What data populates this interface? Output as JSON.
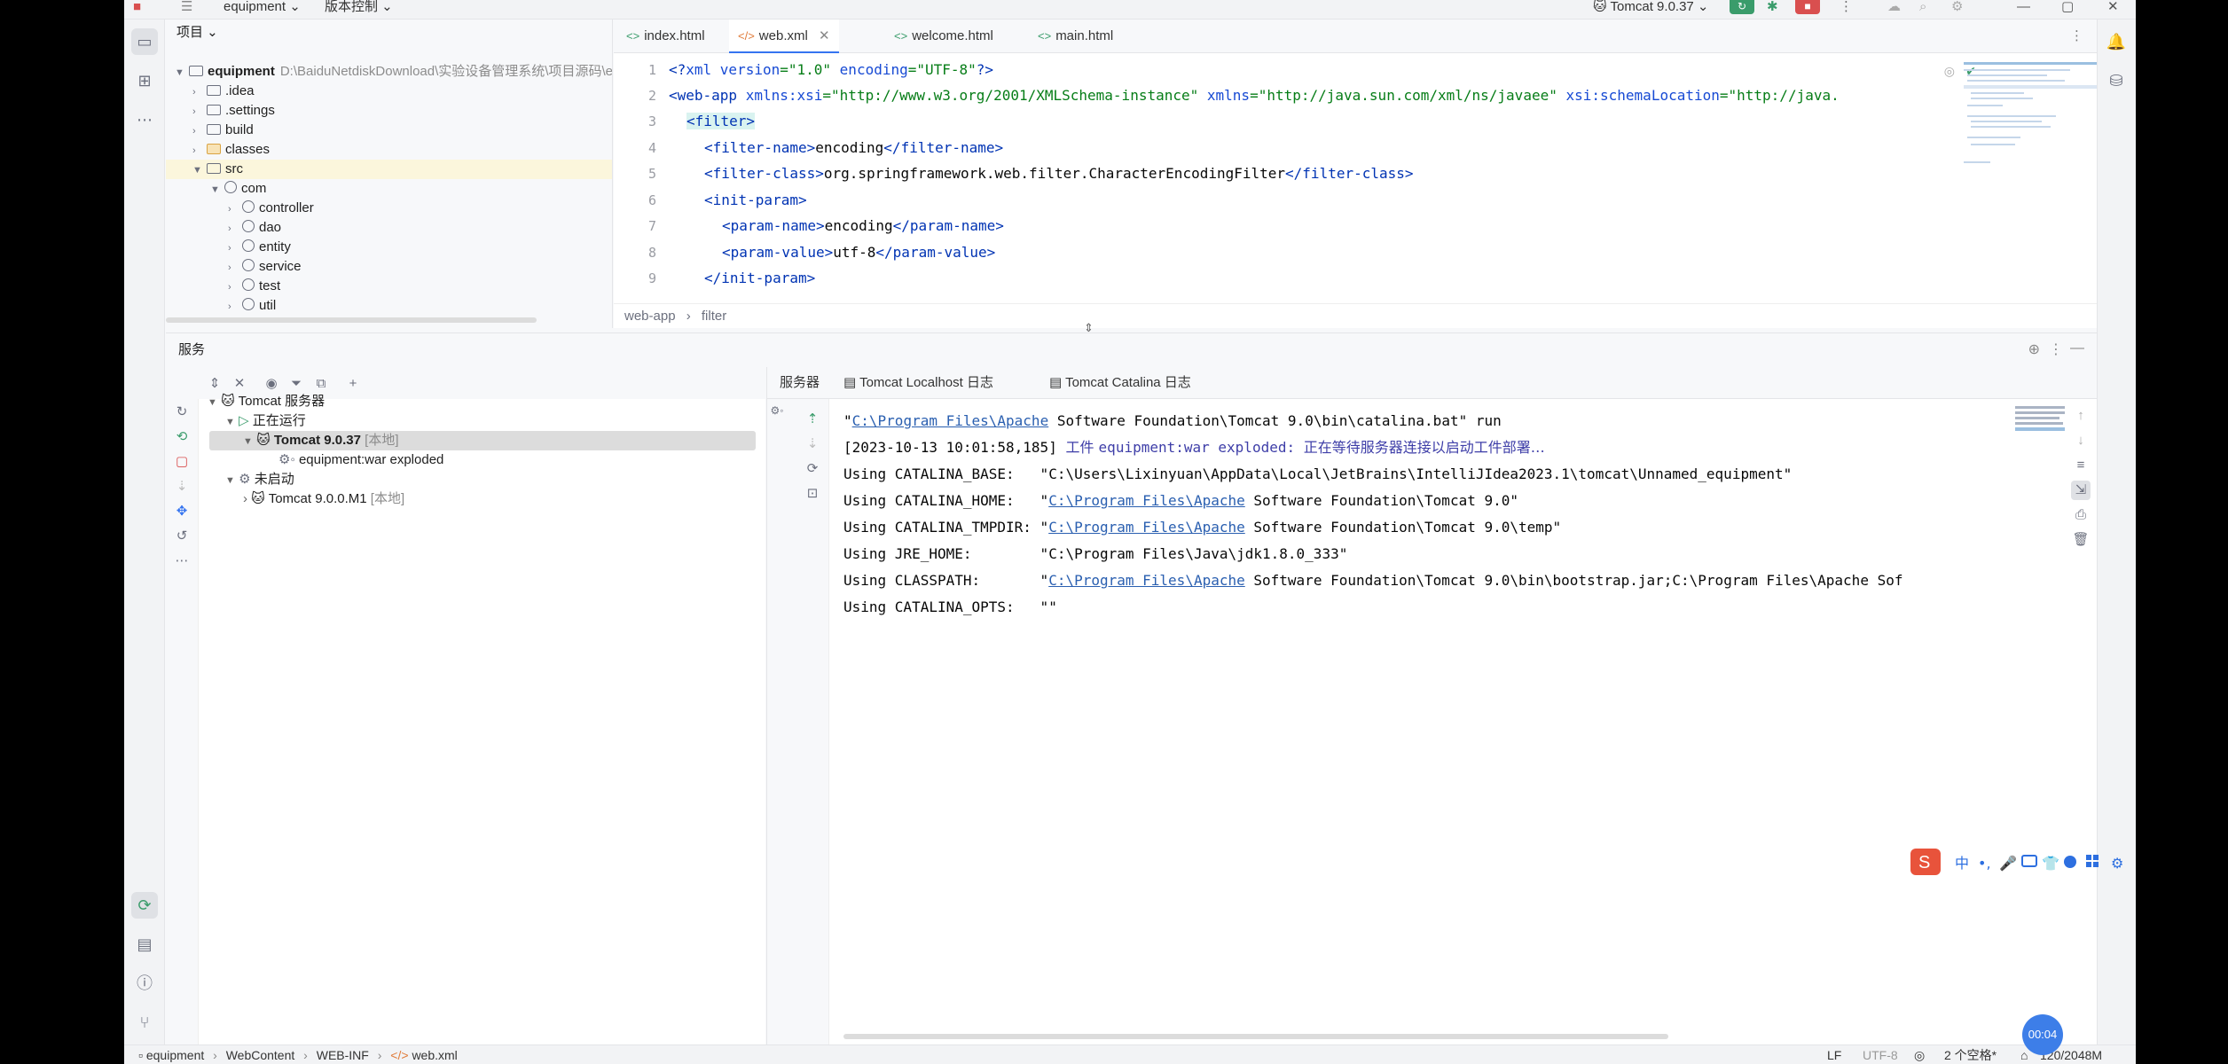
{
  "titlebar": {
    "project": "equipment",
    "vcs": "版本控制",
    "run_config": "Tomcat 9.0.37"
  },
  "project_panel": {
    "title": "项目",
    "tree": [
      {
        "name": "equipment",
        "path": "D:\\BaiduNetdiskDownload\\实验设备管理系统\\项目源码\\e",
        "depth": 0,
        "expanded": true
      },
      {
        "name": ".idea",
        "depth": 1
      },
      {
        "name": ".settings",
        "depth": 1
      },
      {
        "name": "build",
        "depth": 1
      },
      {
        "name": "classes",
        "depth": 1,
        "highlight": true
      },
      {
        "name": "src",
        "depth": 1,
        "expanded": true
      },
      {
        "name": "com",
        "depth": 2,
        "expanded": true
      },
      {
        "name": "controller",
        "depth": 3
      },
      {
        "name": "dao",
        "depth": 3
      },
      {
        "name": "entity",
        "depth": 3
      },
      {
        "name": "service",
        "depth": 3
      },
      {
        "name": "test",
        "depth": 3
      },
      {
        "name": "util",
        "depth": 3
      }
    ]
  },
  "editor": {
    "tabs": [
      "index.html",
      "web.xml",
      "welcome.html",
      "main.html"
    ],
    "active_tab": "web.xml",
    "breadcrumb": [
      "web-app",
      "filter"
    ],
    "line_numbers": [
      "1",
      "2",
      "3",
      "4",
      "5",
      "6",
      "7",
      "8",
      "9"
    ],
    "lines": {
      "l1_a": "<?",
      "l1_b": "xml version",
      "l1_c": "=\"1.0\" ",
      "l1_d": "encoding",
      "l1_e": "=\"UTF-8\"",
      "l1_f": "?>",
      "l2_tag": "<web-app ",
      "l2_a1": "xmlns:xsi",
      "l2_v1": "=\"http://www.w3.org/2001/XMLSchema-instance\" ",
      "l2_a2": "xmlns",
      "l2_v2": "=\"http://java.sun.com/xml/ns/javaee\" ",
      "l2_a3": "xsi:schemaLocation",
      "l2_v3": "=\"http://java.",
      "l3": "<filter>",
      "l4_open": "<filter-name>",
      "l4_text": "encoding",
      "l4_close": "</filter-name>",
      "l5_open": "<filter-class>",
      "l5_text": "org.springframework.web.filter.CharacterEncodingFilter",
      "l5_close": "</filter-class>",
      "l6": "<init-param>",
      "l7_open": "<param-name>",
      "l7_text": "encoding",
      "l7_close": "</param-name>",
      "l8_open": "<param-value>",
      "l8_text": "utf-8",
      "l8_close": "</param-value>",
      "l9": "</init-param>"
    }
  },
  "services": {
    "title": "服务",
    "tree": {
      "root": "Tomcat 服务器",
      "running": "正在运行",
      "server1": "Tomcat 9.0.37",
      "server1_tag": "[本地]",
      "artifact": "equipment:war exploded",
      "stopped": "未启动",
      "server2": "Tomcat 9.0.0.M1",
      "server2_tag": "[本地]"
    },
    "console_tabs": [
      "服务器",
      "Tomcat Localhost 日志",
      "Tomcat Catalina 日志"
    ],
    "console": {
      "line1_q": "\"",
      "line1_link": "C:\\Program Files\\Apache",
      "line1_rest": " Software Foundation\\Tomcat 9.0\\bin\\catalina.bat\" run",
      "line2_ts": "[2023-10-13 10:01:58,185] ",
      "line2_zh1": "工件 ",
      "line2_art": "equipment:war exploded: ",
      "line2_zh2": "正在等待服务器连接以启动工件部署…",
      "line3": "Using CATALINA_BASE:   \"C:\\Users\\Lixinyuan\\AppData\\Local\\JetBrains\\IntelliJIdea2023.1\\tomcat\\Unnamed_equipment\"",
      "line4_pre": "Using CATALINA_HOME:   \"",
      "line4_link": "C:\\Program Files\\Apache",
      "line4_rest": " Software Foundation\\Tomcat 9.0\"",
      "line5_pre": "Using CATALINA_TMPDIR: \"",
      "line5_link": "C:\\Program Files\\Apache",
      "line5_rest": " Software Foundation\\Tomcat 9.0\\temp\"",
      "line6": "Using JRE_HOME:        \"C:\\Program Files\\Java\\jdk1.8.0_333\"",
      "line7_pre": "Using CLASSPATH:       \"",
      "line7_link": "C:\\Program Files\\Apache",
      "line7_rest": " Software Foundation\\Tomcat 9.0\\bin\\bootstrap.jar;C:\\Program Files\\Apache Sof",
      "line8": "Using CATALINA_OPTS:   \"\""
    }
  },
  "statusbar": {
    "breadcrumb": [
      "equipment",
      "WebContent",
      "WEB-INF",
      "web.xml"
    ],
    "line_sep": "LF",
    "encoding": "UTF-8",
    "indent": "2 个空格*",
    "memory": "120/2048M"
  },
  "timer": "00:04",
  "colors": {
    "accent": "#3574f0",
    "run_green": "#3a9c6b",
    "stop_red": "#d94f4f"
  }
}
